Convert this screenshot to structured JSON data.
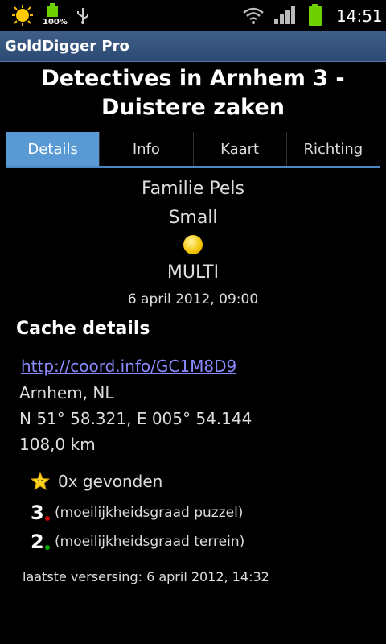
{
  "status_bar": {
    "battery_small_label": "100%",
    "time": "14:51",
    "icons": [
      "weather-sun-icon",
      "battery-icon",
      "usb-icon",
      "wifi-icon",
      "signal-icon",
      "battery-icon"
    ]
  },
  "app": {
    "title": "GoldDigger Pro"
  },
  "cache": {
    "title": "Detectives in Arnhem 3 - Duistere zaken",
    "owner": "Familie Pels",
    "size": "Small",
    "type": "MULTI",
    "date": "6 april 2012, 09:00"
  },
  "tabs": [
    {
      "label": "Details",
      "active": true
    },
    {
      "label": "Info",
      "active": false
    },
    {
      "label": "Kaart",
      "active": false
    },
    {
      "label": "Richting",
      "active": false
    }
  ],
  "details": {
    "section_title": "Cache details",
    "link": "http://coord.info/GC1M8D9",
    "location": "Arnhem, NL",
    "coordinates": "N 51° 58.321, E 005° 54.144",
    "distance": "108,0 km",
    "found": "0x gevonden",
    "difficulty_value": "3",
    "difficulty_label": "(moeilijkheidsgraad puzzel)",
    "terrain_value": "2",
    "terrain_label": "(moeilijkheidsgraad terrein)",
    "last_update": "laatste versersing: 6 april 2012, 14:32"
  },
  "colors": {
    "tab_active": "#5a9ad4",
    "appbar": "#3f5f8a",
    "link": "#8a8aff",
    "difficulty_dot": "#cc0000",
    "terrain_dot": "#00aa00"
  }
}
